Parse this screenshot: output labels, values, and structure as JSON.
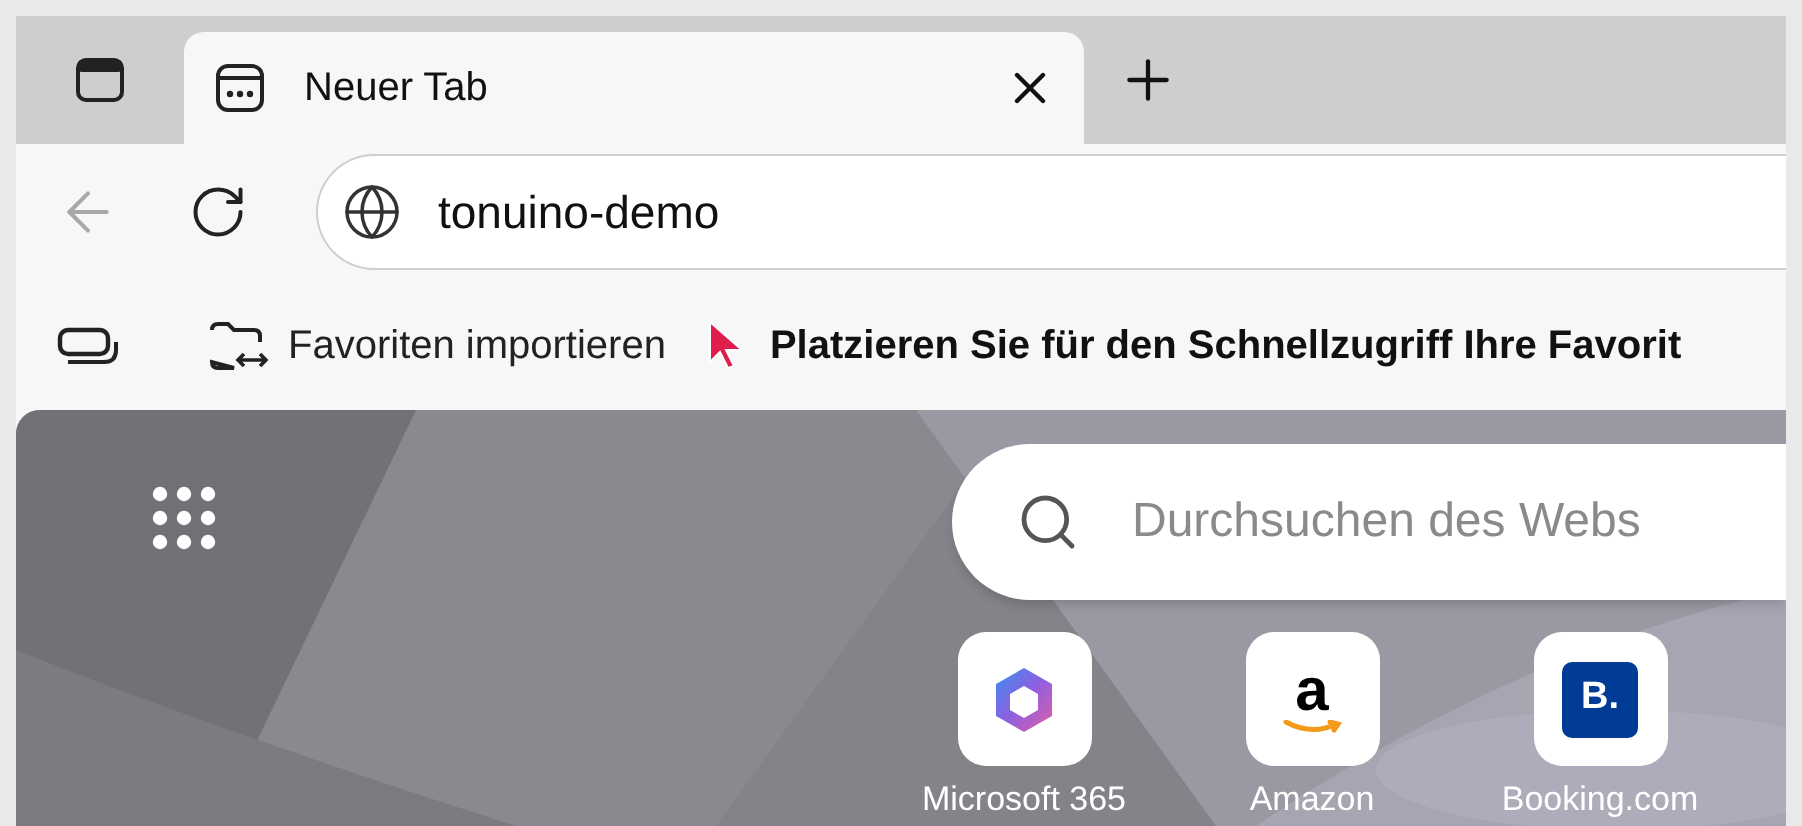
{
  "tabs": [
    {
      "title": "Neuer Tab",
      "selected": true
    }
  ],
  "navigation": {
    "back_disabled": true
  },
  "address_bar": {
    "value": "tonuino-demo"
  },
  "favorites_bar": {
    "items": [
      {
        "label": "Favoriten importieren"
      }
    ],
    "message": "Platzieren Sie für den Schnellzugriff Ihre Favorit"
  },
  "search": {
    "placeholder": "Durchsuchen des Webs"
  },
  "quick_links": [
    {
      "label": "Microsoft 365",
      "kind": "m365"
    },
    {
      "label": "Amazon",
      "kind": "amazon",
      "logo_text": "a"
    },
    {
      "label": "Booking.com",
      "kind": "booking",
      "logo_text": "B."
    }
  ]
}
